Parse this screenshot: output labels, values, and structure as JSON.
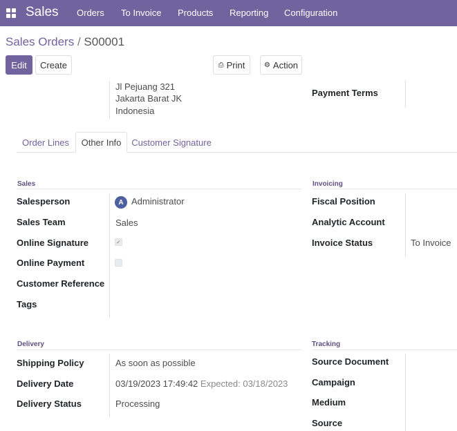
{
  "navbar": {
    "brand": "Sales",
    "menu": [
      "Orders",
      "To Invoice",
      "Products",
      "Reporting",
      "Configuration"
    ]
  },
  "breadcrumb": {
    "parent": "Sales Orders",
    "separator": "/",
    "current": "S00001"
  },
  "toolbar": {
    "edit": "Edit",
    "create": "Create",
    "print": "Print",
    "action": "Action"
  },
  "address": [
    "Jl Pejuang 321",
    "Jakarta Barat JK",
    "Indonesia"
  ],
  "payment_terms_label": "Payment Terms",
  "tabs": [
    "Order Lines",
    "Other Info",
    "Customer Signature"
  ],
  "sales": {
    "title": "Sales",
    "salesperson_label": "Salesperson",
    "salesperson_initial": "A",
    "salesperson": "Administrator",
    "sales_team_label": "Sales Team",
    "sales_team": "Sales",
    "online_signature_label": "Online Signature",
    "online_signature_checked": true,
    "online_payment_label": "Online Payment",
    "online_payment_checked": false,
    "customer_reference_label": "Customer Reference",
    "tags_label": "Tags"
  },
  "invoicing": {
    "title": "Invoicing",
    "fiscal_position_label": "Fiscal Position",
    "analytic_account_label": "Analytic Account",
    "invoice_status_label": "Invoice Status",
    "invoice_status": "To Invoice"
  },
  "delivery": {
    "title": "Delivery",
    "shipping_policy_label": "Shipping Policy",
    "shipping_policy": "As soon as possible",
    "delivery_date_label": "Delivery Date",
    "delivery_date": "03/19/2023 17:49:42",
    "expected": "Expected: 03/18/2023",
    "delivery_status_label": "Delivery Status",
    "delivery_status": "Processing"
  },
  "tracking": {
    "title": "Tracking",
    "source_document_label": "Source Document",
    "campaign_label": "Campaign",
    "medium_label": "Medium",
    "source_label": "Source"
  },
  "colors": {
    "brand": "#71639e",
    "avatar": "#4c5f9e"
  }
}
